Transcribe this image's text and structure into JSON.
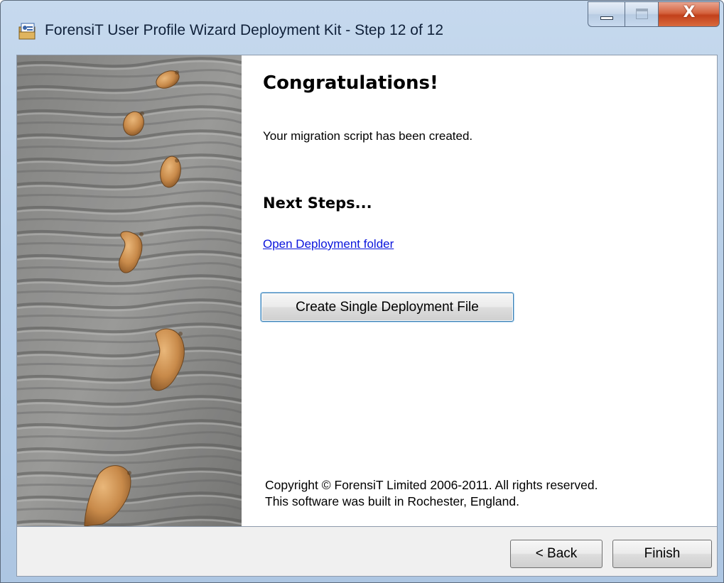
{
  "window": {
    "title": "ForensiT User Profile Wizard Deployment Kit - Step 12 of 12",
    "controls": {
      "close_glyph": "X"
    }
  },
  "content": {
    "heading": "Congratulations!",
    "message": "Your migration script has been created.",
    "next_steps_heading": "Next Steps...",
    "open_folder_link": "Open Deployment folder",
    "create_file_button": "Create Single Deployment File",
    "copyright_line1": "Copyright © ForensiT Limited 2006-2011. All rights reserved.",
    "copyright_line2": "This software was built in Rochester, England."
  },
  "footer": {
    "back_button": "< Back",
    "finish_button": "Finish"
  },
  "icons": [
    "app-icon",
    "minimize-icon",
    "maximize-icon",
    "close-icon"
  ],
  "image": {
    "subject": "footprints-in-sand-image"
  }
}
